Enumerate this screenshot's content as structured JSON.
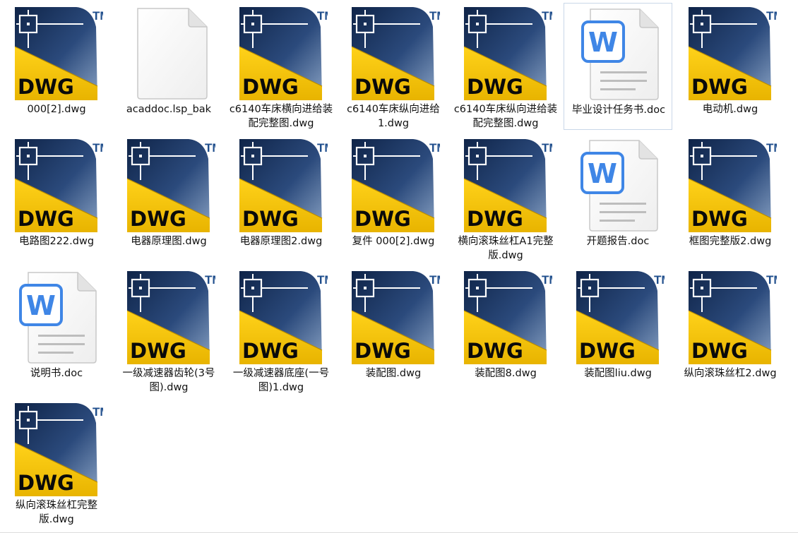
{
  "files": [
    {
      "name": "000[2].dwg",
      "type": "dwg",
      "selected": false
    },
    {
      "name": "acaddoc.lsp_bak",
      "type": "blank",
      "selected": false
    },
    {
      "name": "c6140车床横向进给装配完整图.dwg",
      "type": "dwg",
      "selected": false
    },
    {
      "name": "c6140车床纵向进给1.dwg",
      "type": "dwg",
      "selected": false
    },
    {
      "name": "c6140车床纵向进给装配完整图.dwg",
      "type": "dwg",
      "selected": false
    },
    {
      "name": "毕业设计任务书.doc",
      "type": "doc",
      "selected": true
    },
    {
      "name": "电动机.dwg",
      "type": "dwg",
      "selected": false
    },
    {
      "name": "电路图222.dwg",
      "type": "dwg",
      "selected": false
    },
    {
      "name": "电器原理图.dwg",
      "type": "dwg",
      "selected": false
    },
    {
      "name": "电器原理图2.dwg",
      "type": "dwg",
      "selected": false
    },
    {
      "name": "复件 000[2].dwg",
      "type": "dwg",
      "selected": false
    },
    {
      "name": "横向滚珠丝杠A1完整版.dwg",
      "type": "dwg",
      "selected": false
    },
    {
      "name": "开题报告.doc",
      "type": "doc",
      "selected": false
    },
    {
      "name": "框图完整版2.dwg",
      "type": "dwg",
      "selected": false
    },
    {
      "name": "说明书.doc",
      "type": "doc",
      "selected": false
    },
    {
      "name": "一级减速器齿轮(3号图).dwg",
      "type": "dwg",
      "selected": false
    },
    {
      "name": "一级减速器底座(一号图)1.dwg",
      "type": "dwg",
      "selected": false
    },
    {
      "name": "装配图.dwg",
      "type": "dwg",
      "selected": false
    },
    {
      "name": "装配图8.dwg",
      "type": "dwg",
      "selected": false
    },
    {
      "name": "装配图liu.dwg",
      "type": "dwg",
      "selected": false
    },
    {
      "name": "纵向滚珠丝杠2.dwg",
      "type": "dwg",
      "selected": false
    },
    {
      "name": "纵向滚珠丝杠完整版.dwg",
      "type": "dwg",
      "selected": false
    }
  ],
  "icons": {
    "dwg": {
      "badge_text": "DWG",
      "tm_text": "TM",
      "yellow": "#f2c200",
      "navy": "#1c3561",
      "tm_color": "#1f4e8c"
    },
    "doc": {
      "letter": "W",
      "accent": "#3f86e6"
    }
  }
}
